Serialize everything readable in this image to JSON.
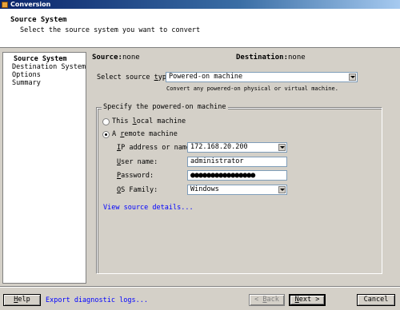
{
  "window": {
    "title": "Conversion"
  },
  "header": {
    "title": "Source System",
    "subtitle": "Select the source system you want to convert"
  },
  "sidebar": {
    "items": [
      {
        "label": "Source System",
        "active": true
      },
      {
        "label": "Destination System",
        "active": false
      },
      {
        "label": "Options",
        "active": false
      },
      {
        "label": "Summary",
        "active": false
      }
    ]
  },
  "main": {
    "source_label": "Source:",
    "source_value": "none",
    "destination_label": "Destination:",
    "destination_value": "none",
    "source_type": {
      "label_pre": "Select source ",
      "label_u": "t",
      "label_post": "ype:",
      "value": "Powered-on machine",
      "description": "Convert any powered-on physical or virtual machine."
    },
    "group": {
      "title": "Specify the powered-on machine",
      "radio_local": {
        "pre": "This ",
        "u": "l",
        "post": "ocal machine",
        "checked": false
      },
      "radio_remote": {
        "pre": "A ",
        "u": "r",
        "post": "emote machine",
        "checked": true
      },
      "ip": {
        "pre": "",
        "u": "I",
        "post": "P address or name:",
        "value": "172.168.20.200"
      },
      "user": {
        "pre": "",
        "u": "U",
        "post": "ser name:",
        "value": "administrator"
      },
      "password": {
        "pre": "",
        "u": "P",
        "post": "assword:",
        "value": "●●●●●●●●●●●●●●●●"
      },
      "os": {
        "pre": "",
        "u": "O",
        "post": "S Family:",
        "value": "Windows"
      },
      "details_link": "View source details..."
    }
  },
  "footer": {
    "help": {
      "pre": "",
      "u": "H",
      "post": "elp"
    },
    "export_link": "Export diagnostic logs...",
    "back": {
      "pre": "< ",
      "u": "B",
      "post": "ack"
    },
    "next": {
      "pre": "",
      "u": "N",
      "post": "ext >"
    },
    "cancel": "Cancel"
  }
}
